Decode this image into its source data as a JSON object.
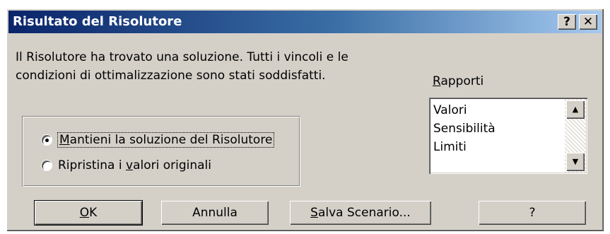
{
  "window": {
    "title": "Risultato del Risolutore",
    "help_button": "?",
    "close_button": "✕"
  },
  "message": {
    "line1": "Il Risolutore ha trovato una soluzione. Tutti i vincoli e le",
    "line2": "condizioni di ottimalizzazione sono stati soddisfatti."
  },
  "options": {
    "keep": {
      "label_pre": "",
      "label_u": "M",
      "label_post": "antieni la soluzione del Risolutore",
      "checked": true
    },
    "restore": {
      "label_pre": "Ripristina i ",
      "label_u": "v",
      "label_post": "alori originali",
      "checked": false
    }
  },
  "reports": {
    "label_u": "R",
    "label_post": "apporti",
    "items": [
      "Valori",
      "Sensibilità",
      "Limiti"
    ],
    "scroll_up_icon": "▲",
    "scroll_down_icon": "▼"
  },
  "buttons": {
    "ok_u": "O",
    "ok_post": "K",
    "cancel": "Annulla",
    "save_u": "S",
    "save_post": "alva Scenario...",
    "help": "?"
  }
}
